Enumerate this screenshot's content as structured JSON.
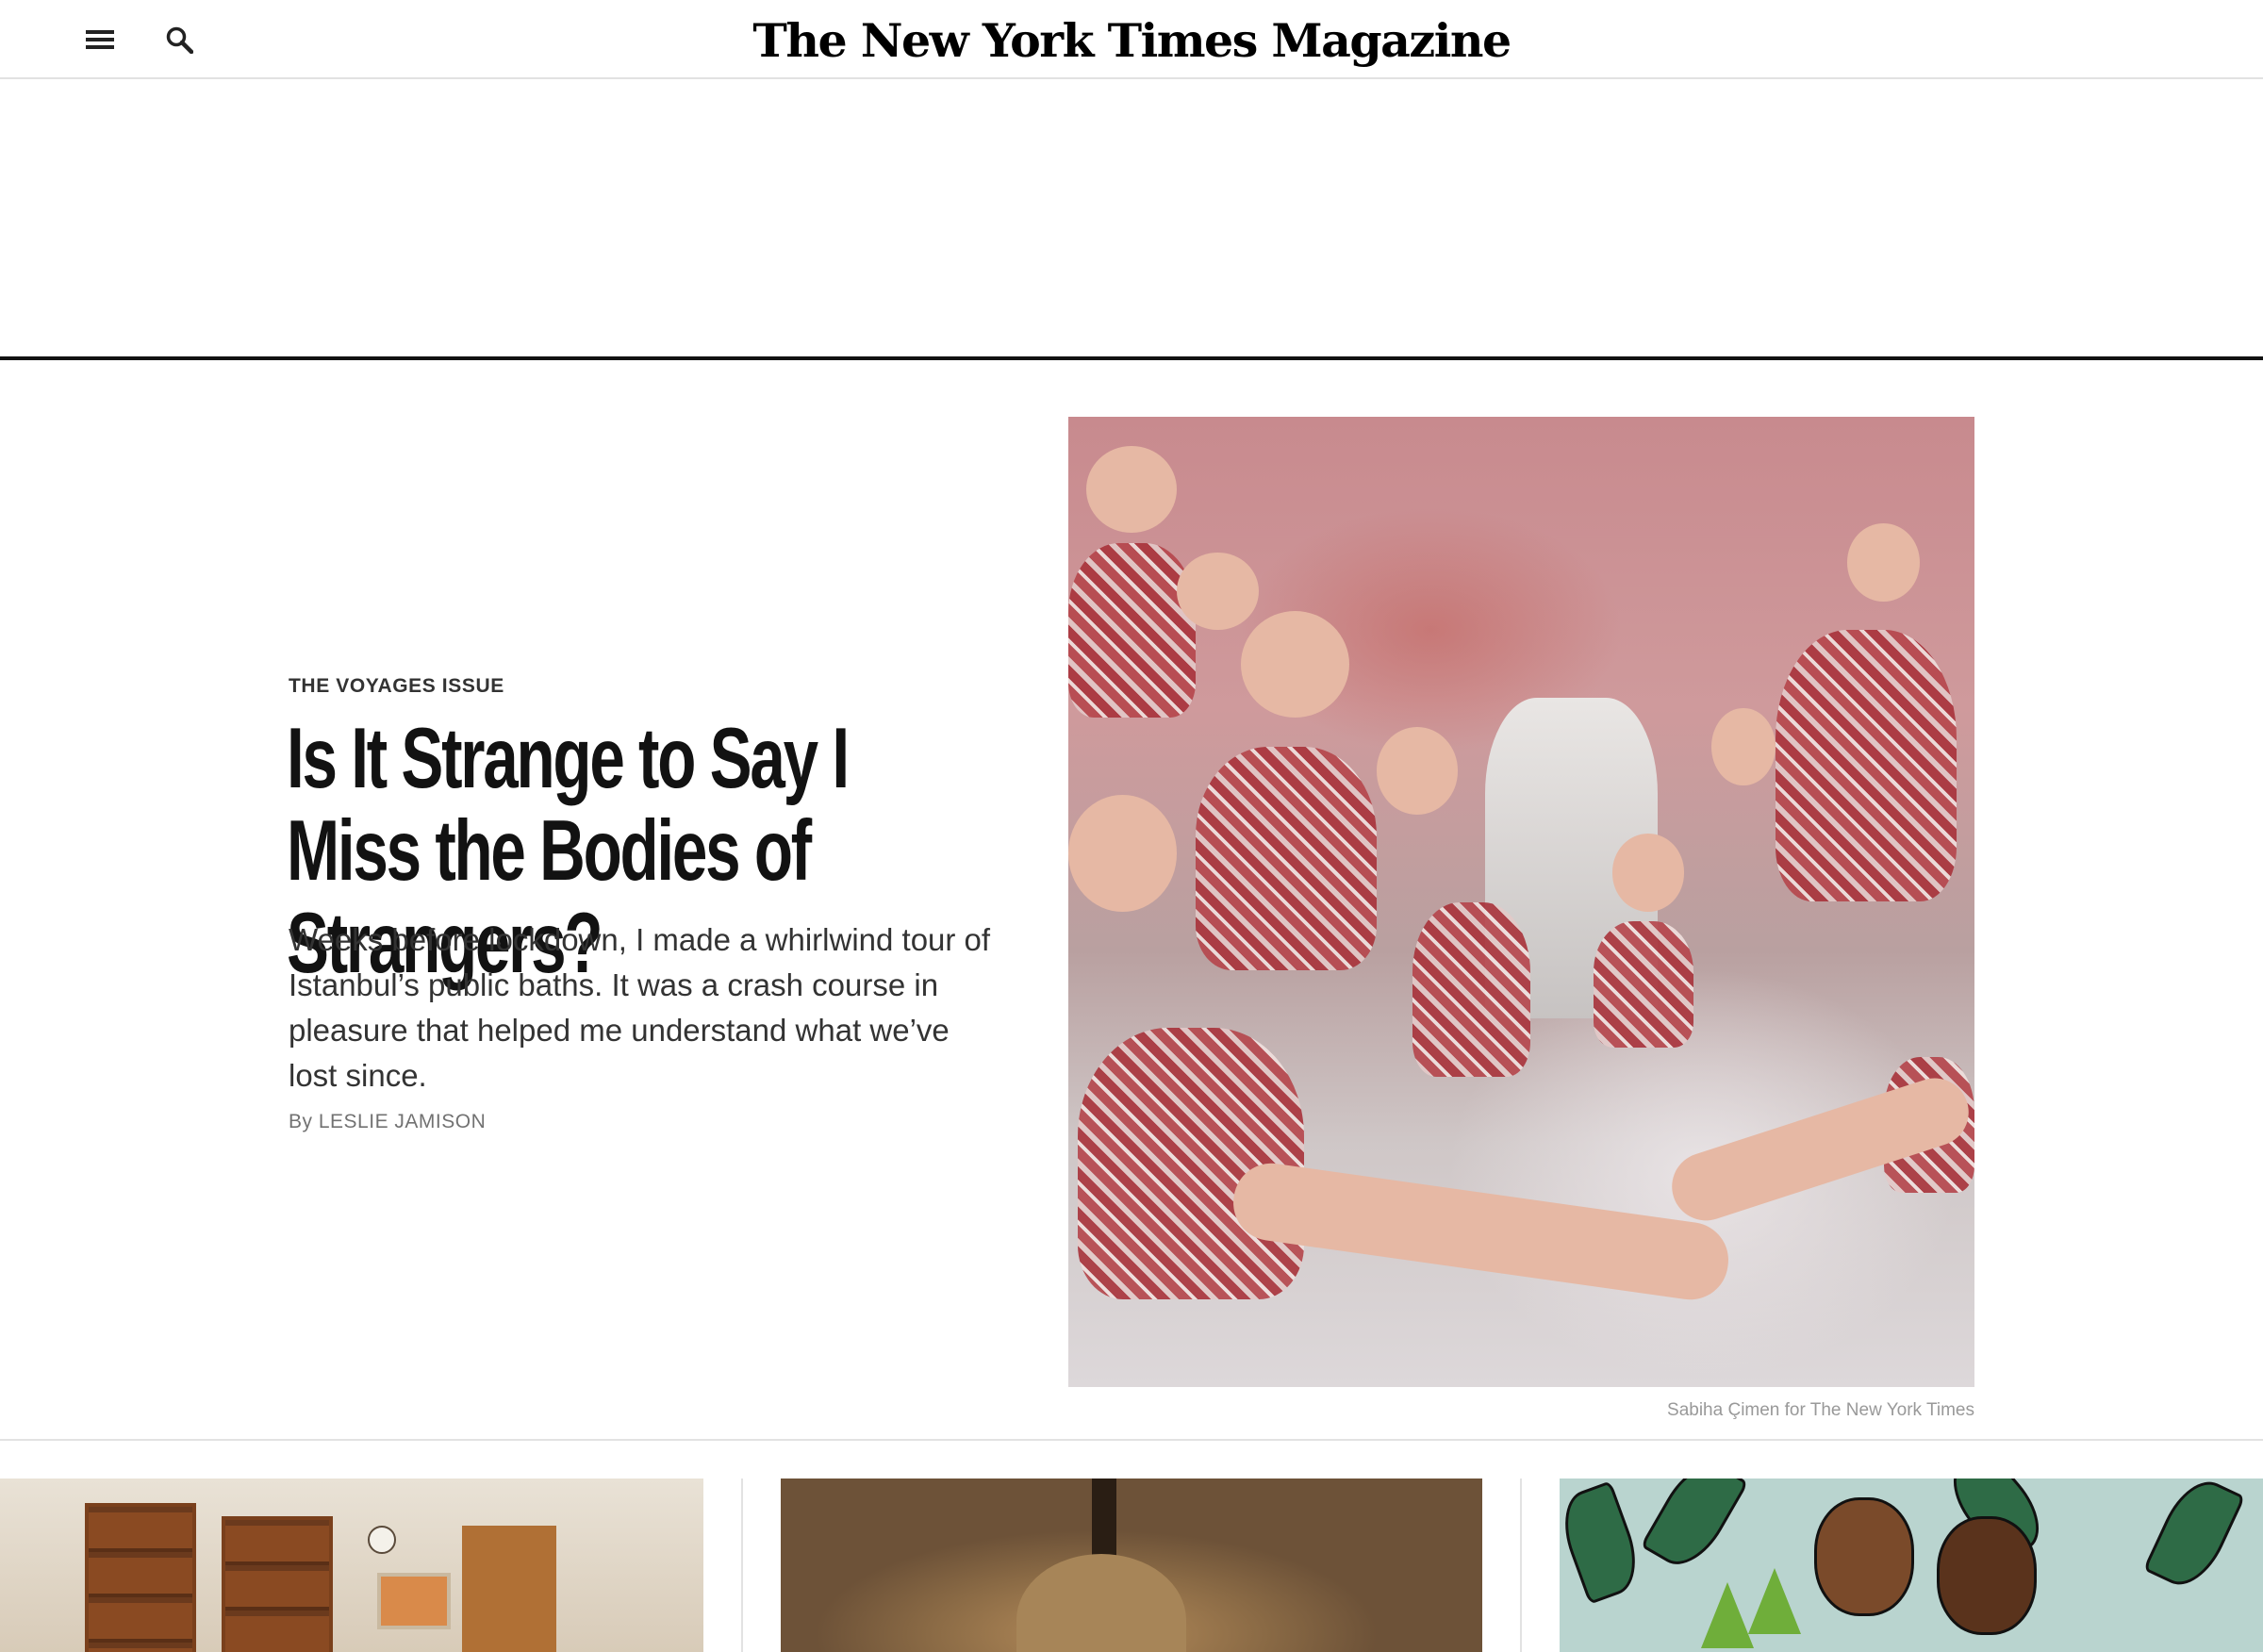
{
  "header": {
    "logo_text": "The New York Times Magazine",
    "menu_icon": "hamburger-menu-icon",
    "search_icon": "search-icon"
  },
  "lead_story": {
    "kicker": "THE VOYAGES ISSUE",
    "headline": "Is It Strange to Say I Miss the Bodies of Strangers?",
    "summary": "Weeks before lockdown, I made a whirlwind tour of Istanbul’s public baths. It was a crash course in pleasure that helped me understand what we’ve lost since.",
    "byline_prefix": "By",
    "byline_author": "LESLIE JAMISON",
    "image_credit": "Sabiha Çimen for The New York Times"
  },
  "colors": {
    "text": "#121212",
    "rule": "#121212",
    "light_rule": "#e2e2e2",
    "credit": "#999999"
  }
}
